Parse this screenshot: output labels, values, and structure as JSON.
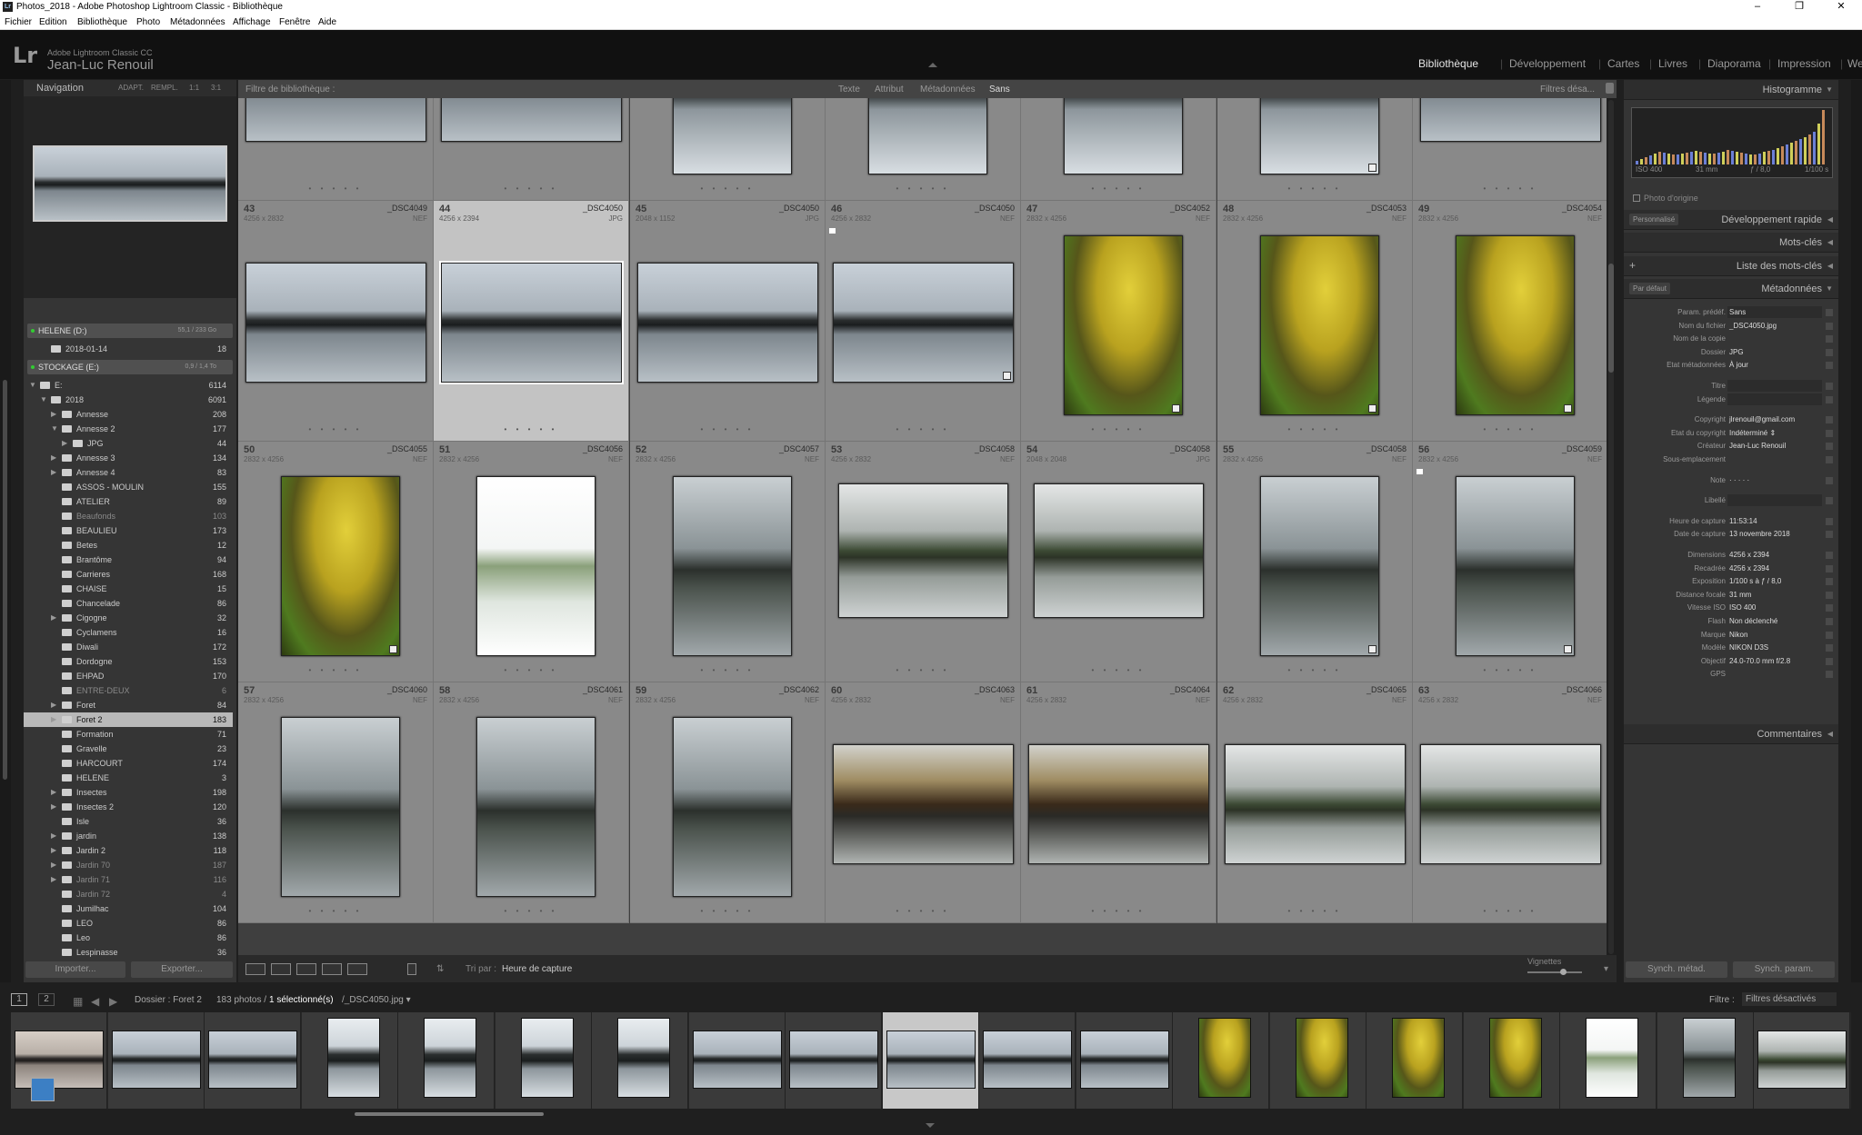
{
  "titlebar": {
    "title": "Photos_2018 - Adobe Photoshop Lightroom Classic - Bibliothèque",
    "app_icon": "Lr",
    "minimize": "–",
    "maximize": "❐",
    "close": "✕"
  },
  "menu": [
    "Fichier",
    "Edition",
    "Bibliothèque",
    "Photo",
    "Métadonnées",
    "Affichage",
    "Fenêtre",
    "Aide"
  ],
  "identity": {
    "logo": "Lr",
    "product": "Adobe Lightroom Classic CC",
    "user": "Jean-Luc Renouil"
  },
  "modules": [
    {
      "label": "Bibliothèque",
      "active": true
    },
    {
      "label": "Développement",
      "active": false
    },
    {
      "label": "Cartes",
      "active": false
    },
    {
      "label": "Livres",
      "active": false
    },
    {
      "label": "Diaporama",
      "active": false
    },
    {
      "label": "Impression",
      "active": false
    },
    {
      "label": "Web",
      "active": false
    }
  ],
  "navigator": {
    "title": "Navigation",
    "options": [
      "ADAPT.",
      "REMPL.",
      "1:1",
      "3:1"
    ]
  },
  "volumes": [
    {
      "name": "HELENE (D:)",
      "size": "55,1 / 233 Go"
    },
    {
      "name": "STOCKAGE (E:)",
      "size": "0,9 / 1,4 To"
    }
  ],
  "folders": [
    {
      "label": "2018-01-14",
      "count": "18",
      "indent": 1,
      "arrow": "",
      "dim": false
    },
    {
      "label": "E:",
      "count": "6114",
      "indent": 0,
      "arrow": "▼",
      "dim": false
    },
    {
      "label": "2018",
      "count": "6091",
      "indent": 1,
      "arrow": "▼",
      "dim": false
    },
    {
      "label": "Annesse",
      "count": "208",
      "indent": 2,
      "arrow": "▶",
      "dim": false
    },
    {
      "label": "Annesse 2",
      "count": "177",
      "indent": 2,
      "arrow": "▼",
      "dim": false
    },
    {
      "label": "JPG",
      "count": "44",
      "indent": 3,
      "arrow": "▶",
      "dim": false
    },
    {
      "label": "Annesse 3",
      "count": "134",
      "indent": 2,
      "arrow": "▶",
      "dim": false
    },
    {
      "label": "Annesse 4",
      "count": "83",
      "indent": 2,
      "arrow": "▶",
      "dim": false
    },
    {
      "label": "ASSOS - MOULIN",
      "count": "155",
      "indent": 2,
      "arrow": "",
      "dim": false
    },
    {
      "label": "ATELIER",
      "count": "89",
      "indent": 2,
      "arrow": "",
      "dim": false
    },
    {
      "label": "Beaufonds",
      "count": "103",
      "indent": 2,
      "arrow": "",
      "dim": true
    },
    {
      "label": "BEAULIEU",
      "count": "173",
      "indent": 2,
      "arrow": "",
      "dim": false
    },
    {
      "label": "Betes",
      "count": "12",
      "indent": 2,
      "arrow": "",
      "dim": false
    },
    {
      "label": "Brantôme",
      "count": "94",
      "indent": 2,
      "arrow": "",
      "dim": false
    },
    {
      "label": "Carrieres",
      "count": "168",
      "indent": 2,
      "arrow": "",
      "dim": false
    },
    {
      "label": "CHAISE",
      "count": "15",
      "indent": 2,
      "arrow": "",
      "dim": false
    },
    {
      "label": "Chancelade",
      "count": "86",
      "indent": 2,
      "arrow": "",
      "dim": false
    },
    {
      "label": "Cigogne",
      "count": "32",
      "indent": 2,
      "arrow": "▶",
      "dim": false
    },
    {
      "label": "Cyclamens",
      "count": "16",
      "indent": 2,
      "arrow": "",
      "dim": false
    },
    {
      "label": "Diwali",
      "count": "172",
      "indent": 2,
      "arrow": "",
      "dim": false
    },
    {
      "label": "Dordogne",
      "count": "153",
      "indent": 2,
      "arrow": "",
      "dim": false
    },
    {
      "label": "EHPAD",
      "count": "170",
      "indent": 2,
      "arrow": "",
      "dim": false
    },
    {
      "label": "ENTRE-DEUX",
      "count": "6",
      "indent": 2,
      "arrow": "",
      "dim": true
    },
    {
      "label": "Foret",
      "count": "84",
      "indent": 2,
      "arrow": "▶",
      "dim": false
    },
    {
      "label": "Foret 2",
      "count": "183",
      "indent": 2,
      "arrow": "▶",
      "dim": false,
      "selected": true
    },
    {
      "label": "Formation",
      "count": "71",
      "indent": 2,
      "arrow": "",
      "dim": false
    },
    {
      "label": "Gravelle",
      "count": "23",
      "indent": 2,
      "arrow": "",
      "dim": false
    },
    {
      "label": "HARCOURT",
      "count": "174",
      "indent": 2,
      "arrow": "",
      "dim": false
    },
    {
      "label": "HELENE",
      "count": "3",
      "indent": 2,
      "arrow": "",
      "dim": false
    },
    {
      "label": "Insectes",
      "count": "198",
      "indent": 2,
      "arrow": "▶",
      "dim": false
    },
    {
      "label": "Insectes 2",
      "count": "120",
      "indent": 2,
      "arrow": "▶",
      "dim": false
    },
    {
      "label": "Isle",
      "count": "36",
      "indent": 2,
      "arrow": "",
      "dim": false
    },
    {
      "label": "jardin",
      "count": "138",
      "indent": 2,
      "arrow": "▶",
      "dim": false
    },
    {
      "label": "Jardin 2",
      "count": "118",
      "indent": 2,
      "arrow": "▶",
      "dim": false
    },
    {
      "label": "Jardin 70",
      "count": "187",
      "indent": 2,
      "arrow": "▶",
      "dim": true
    },
    {
      "label": "Jardin 71",
      "count": "116",
      "indent": 2,
      "arrow": "▶",
      "dim": true
    },
    {
      "label": "Jardin 72",
      "count": "4",
      "indent": 2,
      "arrow": "",
      "dim": true
    },
    {
      "label": "Jumilhac",
      "count": "104",
      "indent": 2,
      "arrow": "",
      "dim": false
    },
    {
      "label": "LEO",
      "count": "86",
      "indent": 2,
      "arrow": "",
      "dim": false
    },
    {
      "label": "Leo",
      "count": "86",
      "indent": 2,
      "arrow": "",
      "dim": false
    },
    {
      "label": "Lespinasse",
      "count": "36",
      "indent": 2,
      "arrow": "",
      "dim": false
    }
  ],
  "left_buttons": {
    "import": "Importer...",
    "export": "Exporter..."
  },
  "filterbar": {
    "title": "Filtre de bibliothèque :",
    "tabs": [
      "Texte",
      "Attribut",
      "Métadonnées",
      "Sans"
    ],
    "right": "Filtres désa..."
  },
  "grid_rows": [
    [
      {
        "num": "",
        "dims": "",
        "file": "",
        "type": "",
        "style": "land",
        "orient": "L",
        "badge": false,
        "selected": false
      },
      {
        "num": "",
        "dims": "",
        "file": "",
        "type": "",
        "style": "land",
        "orient": "L",
        "badge": false,
        "selected": false
      },
      {
        "num": "",
        "dims": "",
        "file": "",
        "type": "",
        "style": "port",
        "orient": "P",
        "badge": false,
        "selected": false
      },
      {
        "num": "",
        "dims": "",
        "file": "",
        "type": "",
        "style": "port",
        "orient": "P",
        "badge": false,
        "selected": false
      },
      {
        "num": "",
        "dims": "",
        "file": "",
        "type": "",
        "style": "port",
        "orient": "P",
        "badge": false,
        "selected": false
      },
      {
        "num": "",
        "dims": "",
        "file": "",
        "type": "",
        "style": "port",
        "orient": "P",
        "badge": true,
        "selected": false
      },
      {
        "num": "",
        "dims": "",
        "file": "",
        "type": "",
        "style": "land",
        "orient": "L",
        "badge": false,
        "selected": false
      }
    ],
    [
      {
        "num": "43",
        "dims": "4256 x 2832",
        "file": "_DSC4049",
        "type": "NEF",
        "style": "land",
        "orient": "L",
        "badge": false,
        "selected": false
      },
      {
        "num": "44",
        "dims": "4256 x 2394",
        "file": "_DSC4050",
        "type": "JPG",
        "style": "land",
        "orient": "L",
        "badge": false,
        "selected": true
      },
      {
        "num": "45",
        "dims": "2048 x 1152",
        "file": "_DSC4050",
        "type": "JPG",
        "style": "land",
        "orient": "L",
        "badge": false,
        "selected": false
      },
      {
        "num": "46",
        "dims": "4256 x 2832",
        "file": "_DSC4050",
        "type": "NEF",
        "style": "land",
        "orient": "L",
        "badge": true,
        "selected": false,
        "flag": true
      },
      {
        "num": "47",
        "dims": "2832 x 4256",
        "file": "_DSC4052",
        "type": "NEF",
        "style": "yellow",
        "orient": "P",
        "badge": true,
        "selected": false
      },
      {
        "num": "48",
        "dims": "2832 x 4256",
        "file": "_DSC4053",
        "type": "NEF",
        "style": "yellow",
        "orient": "P",
        "badge": true,
        "selected": false
      },
      {
        "num": "49",
        "dims": "2832 x 4256",
        "file": "_DSC4054",
        "type": "NEF",
        "style": "yellow",
        "orient": "P",
        "badge": true,
        "selected": false
      }
    ],
    [
      {
        "num": "50",
        "dims": "2832 x 4256",
        "file": "_DSC4055",
        "type": "NEF",
        "style": "yellow",
        "orient": "P",
        "badge": true,
        "selected": false
      },
      {
        "num": "51",
        "dims": "2832 x 4256",
        "file": "_DSC4056",
        "type": "NEF",
        "style": "white",
        "orient": "P",
        "badge": false,
        "selected": false
      },
      {
        "num": "52",
        "dims": "2832 x 4256",
        "file": "_DSC4057",
        "type": "NEF",
        "style": "fogdark",
        "orient": "P",
        "badge": false,
        "selected": false
      },
      {
        "num": "53",
        "dims": "4256 x 2832",
        "file": "_DSC4058",
        "type": "NEF",
        "style": "fogwide",
        "orient": "W",
        "badge": false,
        "selected": false
      },
      {
        "num": "54",
        "dims": "2048 x 2048",
        "file": "_DSC4058",
        "type": "JPG",
        "style": "fogwide",
        "orient": "W",
        "badge": false,
        "selected": false
      },
      {
        "num": "55",
        "dims": "2832 x 4256",
        "file": "_DSC4058",
        "type": "NEF",
        "style": "fogdark",
        "orient": "P",
        "badge": true,
        "selected": false
      },
      {
        "num": "56",
        "dims": "2832 x 4256",
        "file": "_DSC4059",
        "type": "NEF",
        "style": "fogdark",
        "orient": "P",
        "badge": true,
        "selected": false,
        "flag": true
      }
    ],
    [
      {
        "num": "57",
        "dims": "2832 x 4256",
        "file": "_DSC4060",
        "type": "NEF",
        "style": "fogdark",
        "orient": "P",
        "badge": false,
        "selected": false
      },
      {
        "num": "58",
        "dims": "2832 x 4256",
        "file": "_DSC4061",
        "type": "NEF",
        "style": "fogdark",
        "orient": "P",
        "badge": false,
        "selected": false
      },
      {
        "num": "59",
        "dims": "2832 x 4256",
        "file": "_DSC4062",
        "type": "NEF",
        "style": "fogdark",
        "orient": "P",
        "badge": false,
        "selected": false
      },
      {
        "num": "60",
        "dims": "4256 x 2832",
        "file": "_DSC4063",
        "type": "NEF",
        "style": "fogautumn",
        "orient": "L",
        "badge": false,
        "selected": false
      },
      {
        "num": "61",
        "dims": "4256 x 2832",
        "file": "_DSC4064",
        "type": "NEF",
        "style": "fogautumn",
        "orient": "L",
        "badge": false,
        "selected": false
      },
      {
        "num": "62",
        "dims": "4256 x 2832",
        "file": "_DSC4065",
        "type": "NEF",
        "style": "fogwide",
        "orient": "L",
        "badge": false,
        "selected": false
      },
      {
        "num": "63",
        "dims": "4256 x 2832",
        "file": "_DSC4066",
        "type": "NEF",
        "style": "fogwide",
        "orient": "L",
        "badge": false,
        "selected": false
      }
    ]
  ],
  "toolbar": {
    "sort_label": "Tri par :",
    "sort_value": "Heure de capture",
    "thumb_label": "Vignettes"
  },
  "right_panel": {
    "histogram": {
      "title": "Histogramme",
      "iso": "ISO 400",
      "focal": "31 mm",
      "aperture": "ƒ / 8,0",
      "shutter": "1/100 s",
      "original": "Photo d'origine"
    },
    "quick_develop": {
      "title": "Développement rapide",
      "preset": "Personnalisé"
    },
    "keywords": "Mots-clés",
    "keyword_list": "Liste des mots-clés",
    "metadata": {
      "title": "Métadonnées",
      "preset": "Par défaut"
    },
    "meta_rows": [
      {
        "k": "Param. prédéf.",
        "v": "Sans",
        "box": true
      },
      {
        "k": "Nom du fichier",
        "v": "_DSC4050.jpg"
      },
      {
        "k": "Nom de la copie",
        "v": ""
      },
      {
        "k": "Dossier",
        "v": "JPG"
      },
      {
        "k": "Etat métadonnées",
        "v": "À jour"
      },
      {
        "k": "",
        "v": ""
      },
      {
        "k": "Titre",
        "v": "",
        "box": true
      },
      {
        "k": "Légende",
        "v": "",
        "box": true
      },
      {
        "k": "",
        "v": ""
      },
      {
        "k": "Copyright",
        "v": "jlrenouil@gmail.com"
      },
      {
        "k": "Etat du copyright",
        "v": "Indéterminé ⇕"
      },
      {
        "k": "Créateur",
        "v": "Jean-Luc Renouil"
      },
      {
        "k": "Sous-emplacement",
        "v": ""
      },
      {
        "k": "",
        "v": ""
      },
      {
        "k": "Note",
        "v": "·  ·  ·  ·  ·"
      },
      {
        "k": "",
        "v": ""
      },
      {
        "k": "Libellé",
        "v": "",
        "box": true
      },
      {
        "k": "",
        "v": ""
      },
      {
        "k": "Heure de capture",
        "v": "11:53:14"
      },
      {
        "k": "Date de capture",
        "v": "13 novembre 2018"
      },
      {
        "k": "",
        "v": ""
      },
      {
        "k": "Dimensions",
        "v": "4256 x 2394"
      },
      {
        "k": "Recadrée",
        "v": "4256 x 2394"
      },
      {
        "k": "Exposition",
        "v": "1/100 s à ƒ / 8,0"
      },
      {
        "k": "Distance focale",
        "v": "31 mm"
      },
      {
        "k": "Vitesse ISO",
        "v": "ISO 400"
      },
      {
        "k": "Flash",
        "v": "Non déclenché"
      },
      {
        "k": "Marque",
        "v": "Nikon"
      },
      {
        "k": "Modèle",
        "v": "NIKON D3S"
      },
      {
        "k": "Objectif",
        "v": "24.0-70.0 mm f/2.8"
      },
      {
        "k": "GPS",
        "v": ""
      }
    ],
    "comments": "Commentaires",
    "sync_meta": "Synch. métad.",
    "sync_param": "Synch. param."
  },
  "filmstrip": {
    "page1": "1",
    "page2": "2",
    "folder": "Dossier : Foret 2",
    "count": "183 photos /",
    "selected": "1 sélectionné(s)",
    "file": "/_DSC4050.jpg ▾",
    "filter_label": "Filtre :",
    "filter_value": "Filtres désactivés",
    "thumbs": [
      "blue",
      "land",
      "land",
      "port",
      "port",
      "port",
      "port",
      "land",
      "land",
      "land",
      "land",
      "land",
      "yellow",
      "yellow",
      "yellow",
      "yellow",
      "white",
      "fogdark",
      "fogwide"
    ]
  }
}
